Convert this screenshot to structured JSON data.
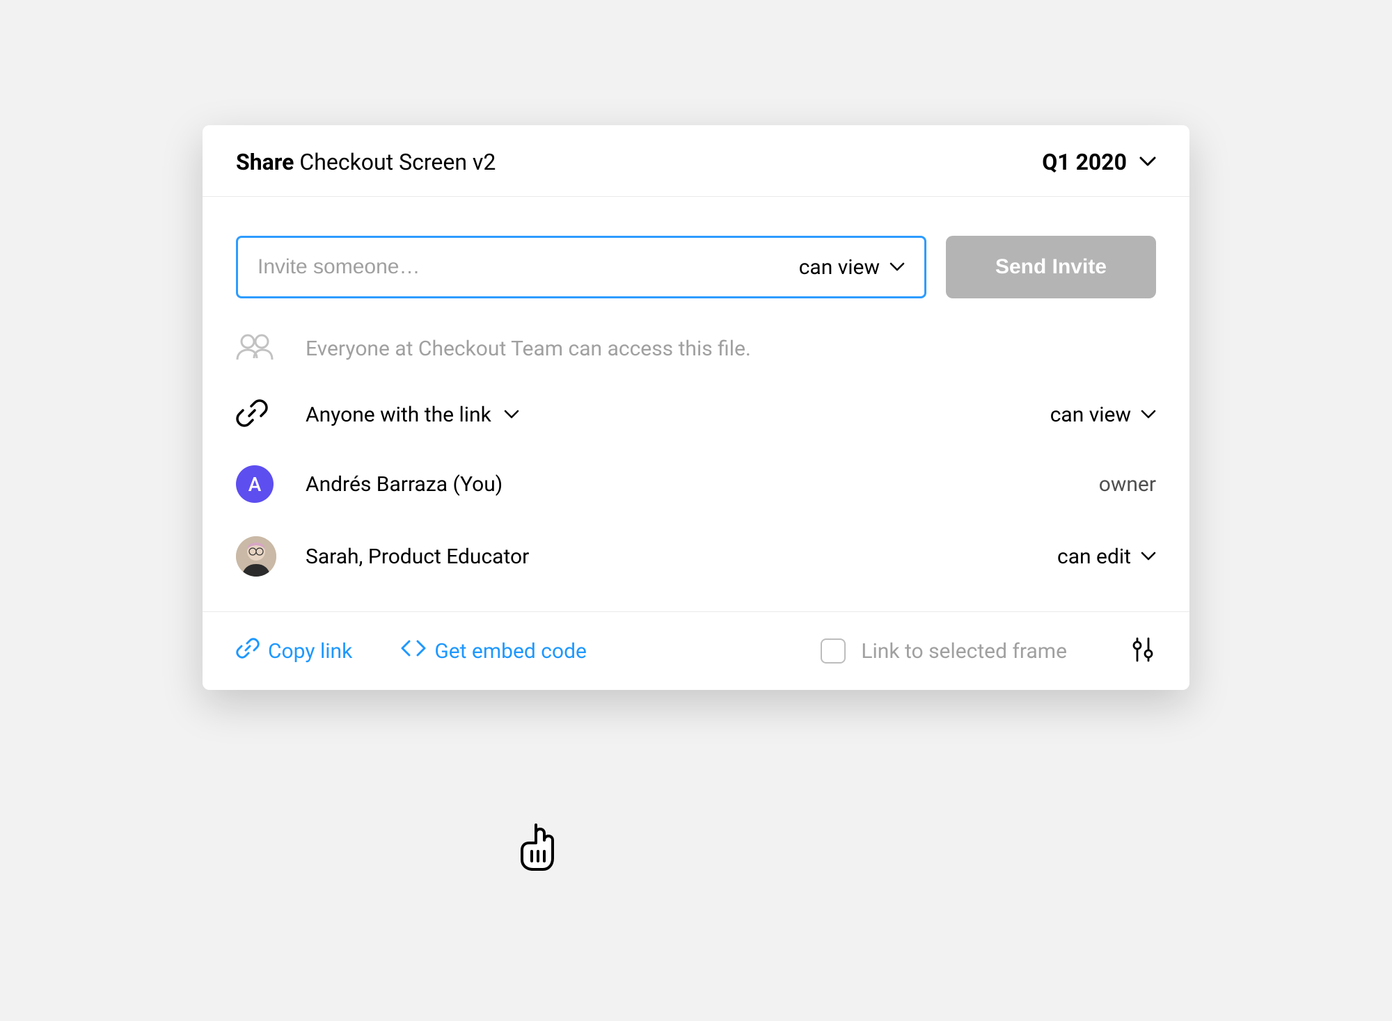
{
  "header": {
    "share_word": "Share",
    "file_name": "Checkout Screen v2",
    "project": "Q1 2020"
  },
  "invite": {
    "placeholder": "Invite someone…",
    "permission": "can view",
    "send_button": "Send Invite"
  },
  "access": {
    "team_line": "Everyone at Checkout Team can access this file.",
    "link_label": "Anyone with the link",
    "link_permission": "can view",
    "people": [
      {
        "name": "Andrés Barraza (You)",
        "role": "owner",
        "role_editable": false,
        "initial": "A",
        "avatar_color": "#5d4ef0"
      },
      {
        "name": "Sarah, Product Educator",
        "role": "can edit",
        "role_editable": true
      }
    ]
  },
  "footer": {
    "copy_link": "Copy link",
    "embed": "Get embed code",
    "frame_link": "Link to selected frame"
  }
}
